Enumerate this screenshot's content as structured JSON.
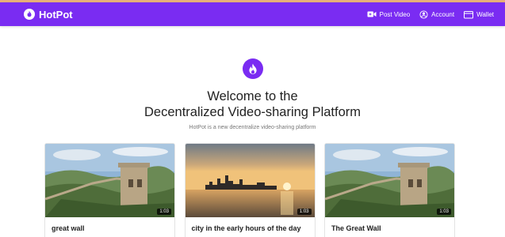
{
  "app": {
    "name": "HotPot"
  },
  "nav": {
    "post_video": "Post Video",
    "account": "Account",
    "wallet": "Wallet"
  },
  "hero": {
    "title_line1": "Welcome to the",
    "title_line2": "Decentralized Video-sharing Platform",
    "subtitle": "HotPot is a new decentralize video-sharing platform"
  },
  "videos": [
    {
      "title": "great wall",
      "duration": "1:03",
      "thumbnail": "great-wall"
    },
    {
      "title": "city in the early hours of the day",
      "duration": "1:03",
      "thumbnail": "city-sunrise"
    },
    {
      "title": "The Great Wall",
      "duration": "1:03",
      "thumbnail": "great-wall"
    }
  ],
  "colors": {
    "brand": "#7a2cf2",
    "top_stripe": "#e9b07a"
  }
}
